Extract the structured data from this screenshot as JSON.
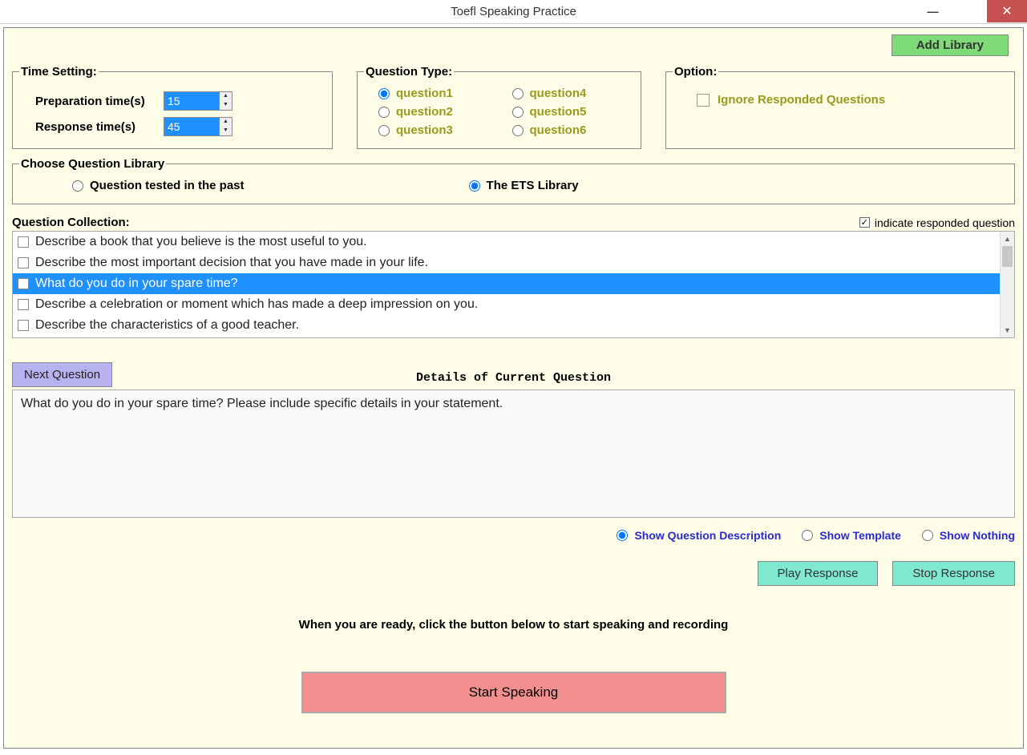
{
  "window": {
    "title": "Toefl Speaking Practice"
  },
  "add_library_label": "Add Library",
  "time_setting": {
    "legend": "Time Setting:",
    "prep_label": "Preparation time(s)",
    "prep_value": "15",
    "resp_label": "Response time(s)",
    "resp_value": "45"
  },
  "question_type": {
    "legend": "Question Type:",
    "items": [
      "question1",
      "question2",
      "question3",
      "question4",
      "question5",
      "question6"
    ],
    "selected_index": 0
  },
  "option": {
    "legend": "Option:",
    "ignore_label": "Ignore Responded Questions"
  },
  "library": {
    "legend": "Choose Question Library",
    "past_label": "Question tested in the past",
    "ets_label": "The ETS Library",
    "selected": "ets"
  },
  "collection": {
    "title": "Question Collection:",
    "indicate_label": "indicate responded question",
    "indicate_checked": true,
    "selected_index": 2,
    "items": [
      "Describe a book that you believe is the most useful to you.",
      "Describe the most important decision that you have made in your life.",
      "What do you do in your spare time?",
      "Describe a celebration or moment which has made a deep impression on you.",
      "Describe the characteristics of a good teacher."
    ]
  },
  "next_question_label": "Next Question",
  "details": {
    "title": "Details of Current Question",
    "text": "What do you do in your spare time? Please include specific details in your statement."
  },
  "show_options": {
    "desc": "Show Question Description",
    "template": "Show Template",
    "nothing": "Show Nothing",
    "selected": "desc"
  },
  "play_response_label": "Play Response",
  "stop_response_label": "Stop Response",
  "ready_text": "When you are ready, click the button below to start speaking and recording",
  "start_label": "Start Speaking"
}
